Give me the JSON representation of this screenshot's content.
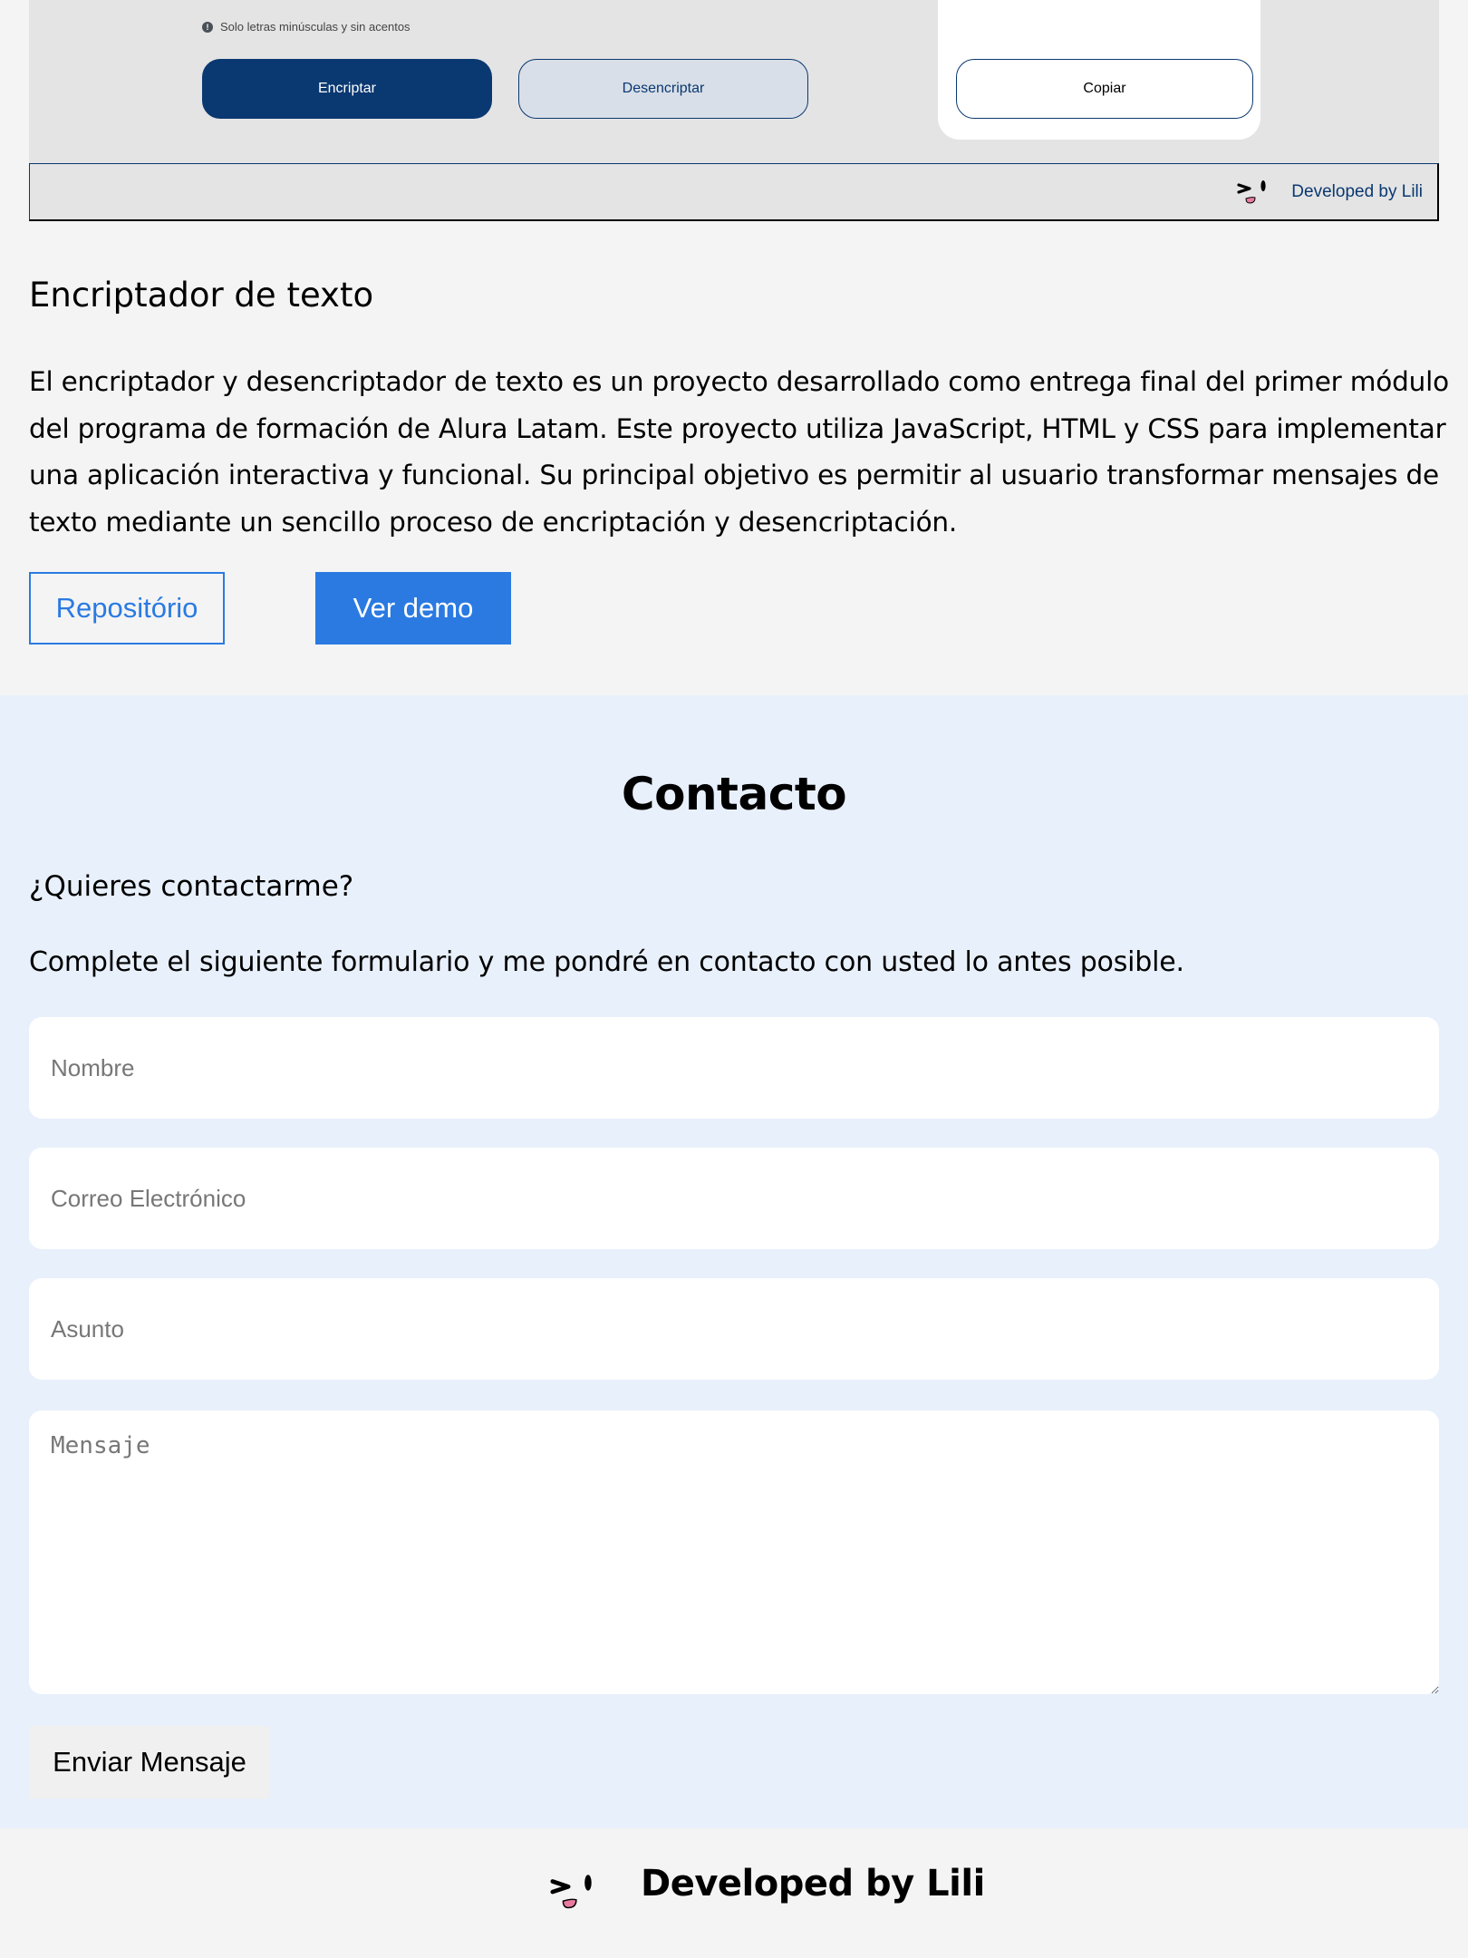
{
  "project_preview": {
    "hint": "Solo letras minúsculas y sin acentos",
    "hint_icon": "info-icon",
    "encrypt_label": "Encriptar",
    "decrypt_label": "Desencriptar",
    "copy_label": "Copiar",
    "footer_text": "Developed by Lili",
    "footer_icon": "winking-face-logo-icon",
    "colors": {
      "primary": "#0a3871",
      "secondary_bg": "#d8dfe8",
      "panel_bg": "#e4e4e4"
    }
  },
  "project": {
    "title": "Encriptador de texto",
    "description": "El encriptador y desencriptador de texto es un proyecto desarrollado como entrega final del primer módulo del programa de formación de Alura Latam. Este proyecto utiliza JavaScript, HTML y CSS para implementar una aplicación interactiva y funcional. Su principal objetivo es permitir al usuario transformar mensajes de texto mediante un sencillo proceso de encriptación y desencriptación.",
    "repo_label": "Repositório",
    "demo_label": "Ver demo",
    "accent_color": "#2a7ae2"
  },
  "contact": {
    "title": "Contacto",
    "question": "¿Quieres contactarme?",
    "lead": "Complete el siguiente formulario y me pondré en contacto con usted lo antes posible.",
    "fields": {
      "name_placeholder": "Nombre",
      "name_value": "",
      "email_placeholder": "Correo Electrónico",
      "email_value": "",
      "subject_placeholder": "Asunto",
      "subject_value": "",
      "message_placeholder": "Mensaje",
      "message_value": ""
    },
    "send_label": "Enviar Mensaje",
    "background_color": "#e8f0fb"
  },
  "footer": {
    "text": "Developed by Lili",
    "icon": "winking-face-logo-icon"
  }
}
